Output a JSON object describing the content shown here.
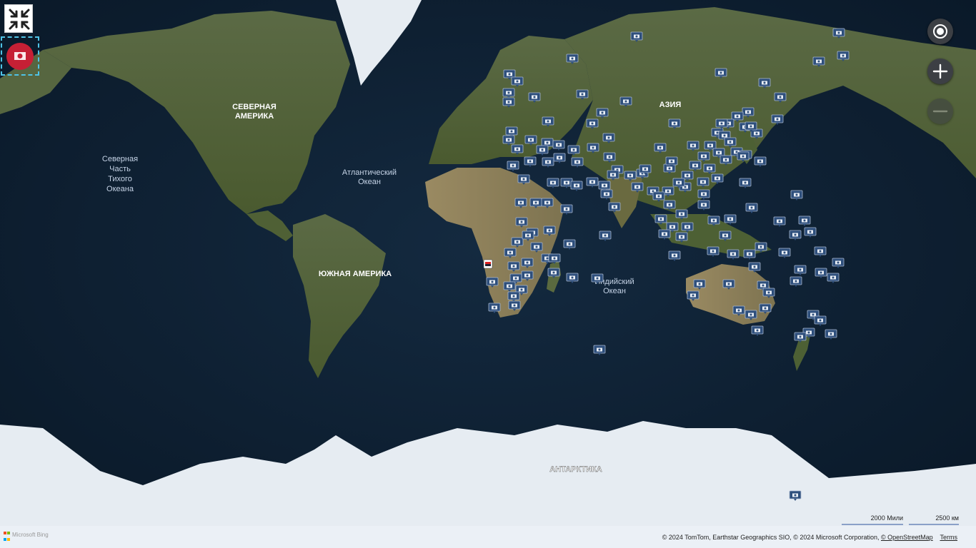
{
  "map": {
    "labels": {
      "north_america": [
        "СЕВЕРНАЯ",
        "АМЕРИКА"
      ],
      "south_america": [
        "ЮЖНАЯ АМЕРИКА"
      ],
      "asia": [
        "АЗИЯ"
      ],
      "antarctica": [
        "АНТАРКТИКА"
      ],
      "north_pacific": [
        "Северная",
        "Часть",
        "Тихого",
        "Океана"
      ],
      "atlantic": [
        "Атлантический",
        "Океан"
      ],
      "indian": [
        "Индийский",
        "Океан"
      ]
    },
    "marker_icon": "camera-icon",
    "highlighted_marker_icon": "flag-marker-icon"
  },
  "controls": {
    "fullscreen_icon": "exit-fullscreen-icon",
    "logo_icon": "site-logo-icon",
    "locate_icon": "locate-me-icon",
    "zoom_in_icon": "plus-icon",
    "zoom_out_icon": "minus-icon"
  },
  "scale": {
    "miles": "2000 Мили",
    "km": "2500 км"
  },
  "footer": {
    "brand": "Microsoft Bing",
    "copyright": "© 2024 TomTom, Earthstar Geographics SIO, © 2024 Microsoft Corporation,",
    "osm_link": "© OpenStreetMap",
    "terms_link": "Terms"
  },
  "colors": {
    "ocean": "#0d1f33",
    "land": "#55653a",
    "ice": "#e6ecf2",
    "marker": "#2e4f7c",
    "logo": "#c62035"
  }
}
